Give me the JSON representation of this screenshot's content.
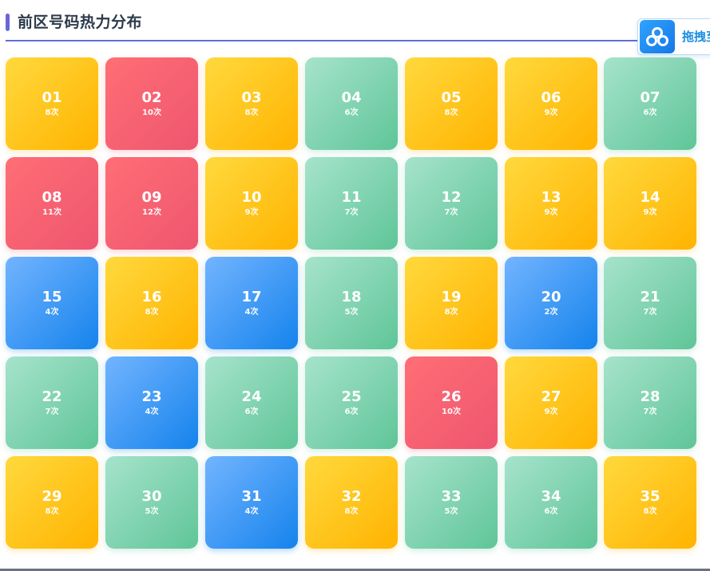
{
  "header": {
    "title": "前区号码热力分布"
  },
  "floating_button": {
    "label": "拖拽至"
  },
  "colors": {
    "yellow": "#ffc107",
    "red": "#f26471",
    "green": "#7fd4b0",
    "blue": "#3d9bf5",
    "accent_line": "#5b6fd6",
    "title_text": "#2d3a4a"
  },
  "cells": [
    {
      "num": "01",
      "count": "8次",
      "level": "yellow"
    },
    {
      "num": "02",
      "count": "10次",
      "level": "red"
    },
    {
      "num": "03",
      "count": "8次",
      "level": "yellow"
    },
    {
      "num": "04",
      "count": "6次",
      "level": "green"
    },
    {
      "num": "05",
      "count": "8次",
      "level": "yellow"
    },
    {
      "num": "06",
      "count": "9次",
      "level": "yellow"
    },
    {
      "num": "07",
      "count": "6次",
      "level": "green"
    },
    {
      "num": "08",
      "count": "11次",
      "level": "red"
    },
    {
      "num": "09",
      "count": "12次",
      "level": "red"
    },
    {
      "num": "10",
      "count": "9次",
      "level": "yellow"
    },
    {
      "num": "11",
      "count": "7次",
      "level": "green"
    },
    {
      "num": "12",
      "count": "7次",
      "level": "green"
    },
    {
      "num": "13",
      "count": "9次",
      "level": "yellow"
    },
    {
      "num": "14",
      "count": "9次",
      "level": "yellow"
    },
    {
      "num": "15",
      "count": "4次",
      "level": "blue"
    },
    {
      "num": "16",
      "count": "8次",
      "level": "yellow"
    },
    {
      "num": "17",
      "count": "4次",
      "level": "blue"
    },
    {
      "num": "18",
      "count": "5次",
      "level": "green"
    },
    {
      "num": "19",
      "count": "8次",
      "level": "yellow"
    },
    {
      "num": "20",
      "count": "2次",
      "level": "blue"
    },
    {
      "num": "21",
      "count": "7次",
      "level": "green"
    },
    {
      "num": "22",
      "count": "7次",
      "level": "green"
    },
    {
      "num": "23",
      "count": "4次",
      "level": "blue"
    },
    {
      "num": "24",
      "count": "6次",
      "level": "green"
    },
    {
      "num": "25",
      "count": "6次",
      "level": "green"
    },
    {
      "num": "26",
      "count": "10次",
      "level": "red"
    },
    {
      "num": "27",
      "count": "9次",
      "level": "yellow"
    },
    {
      "num": "28",
      "count": "7次",
      "level": "green"
    },
    {
      "num": "29",
      "count": "8次",
      "level": "yellow"
    },
    {
      "num": "30",
      "count": "5次",
      "level": "green"
    },
    {
      "num": "31",
      "count": "4次",
      "level": "blue"
    },
    {
      "num": "32",
      "count": "8次",
      "level": "yellow"
    },
    {
      "num": "33",
      "count": "5次",
      "level": "green"
    },
    {
      "num": "34",
      "count": "6次",
      "level": "green"
    },
    {
      "num": "35",
      "count": "8次",
      "level": "yellow"
    }
  ]
}
